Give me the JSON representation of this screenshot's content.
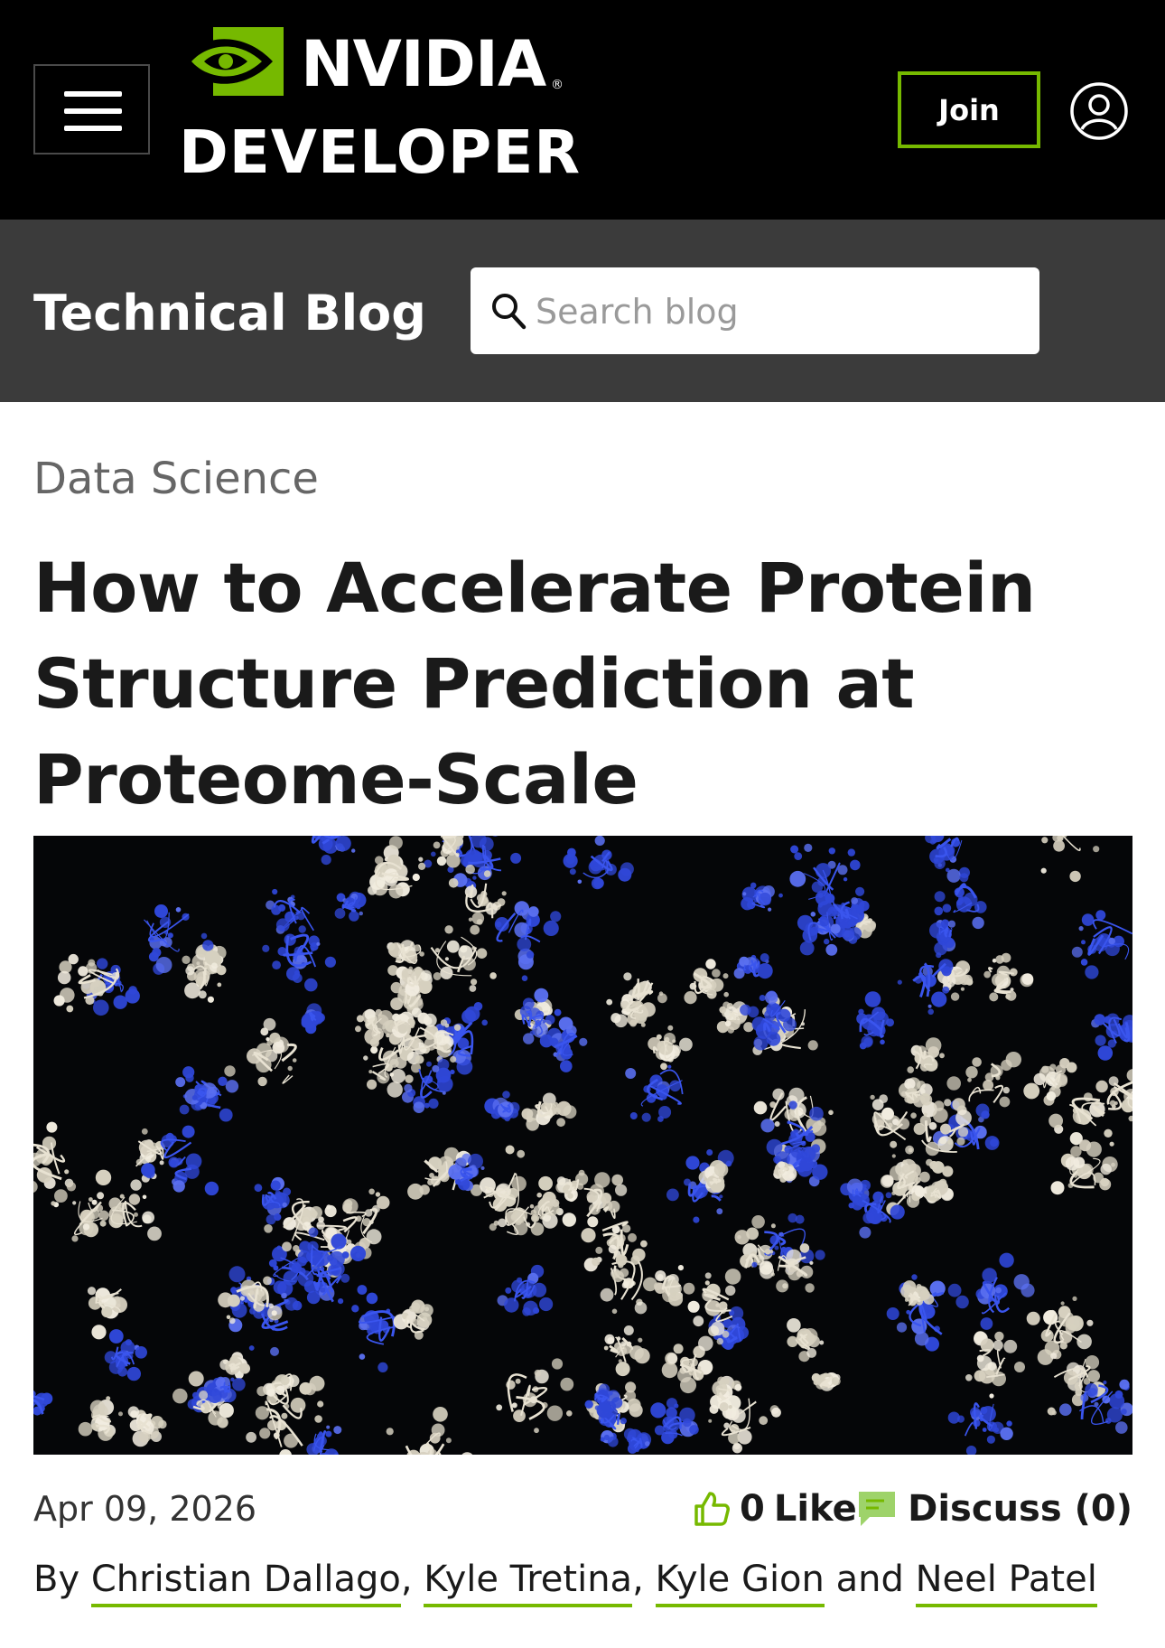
{
  "header": {
    "logo_wordmark": "NVIDIA",
    "logo_subtitle": "DEVELOPER",
    "join_label": "Join",
    "brand_color": "#76b900"
  },
  "blog_bar": {
    "title": "Technical Blog",
    "search_placeholder": "Search blog"
  },
  "article": {
    "category": "Data Science",
    "title": "How to Accelerate Protein Structure Prediction at Proteome-Scale",
    "date": "Apr 09, 2026",
    "likes": {
      "count": "0",
      "label": "Like"
    },
    "discuss_label": "Discuss (0)",
    "byline": {
      "prefix": "By",
      "authors": [
        "Christian Dallago",
        "Kyle Tretina",
        "Kyle Gion",
        "Neel Patel"
      ],
      "sep": ",",
      "conjunction": "and"
    }
  },
  "icons": {
    "menu": "hamburger-menu-icon",
    "user": "user-account-icon",
    "search": "search-icon",
    "like": "thumbs-up-icon",
    "discuss": "chat-bubble-icon"
  }
}
